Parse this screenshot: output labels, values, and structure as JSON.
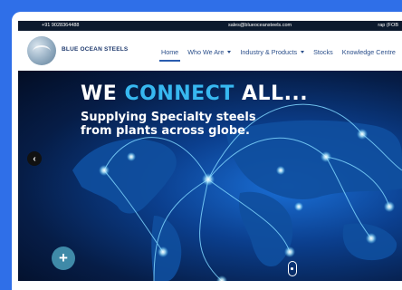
{
  "topbar": {
    "phone": "+91 9028364488",
    "email": "sales@blueoceansteels.com",
    "right_text": "rap (FOB"
  },
  "brand": {
    "logo_text": "BLUE OCEAN STEELS"
  },
  "nav": {
    "items": [
      {
        "label": "Home",
        "active": true,
        "dropdown": false
      },
      {
        "label": "Who We Are",
        "active": false,
        "dropdown": true
      },
      {
        "label": "Industry & Products",
        "active": false,
        "dropdown": true
      },
      {
        "label": "Stocks",
        "active": false,
        "dropdown": false
      },
      {
        "label": "Knowledge Centre",
        "active": false,
        "dropdown": false
      }
    ]
  },
  "hero": {
    "title_part1": "WE",
    "title_part2": "CONNECT",
    "title_part3": "ALL...",
    "subtitle": "Supplying Specialty steels from plants across globe."
  },
  "controls": {
    "prev_glyph": "‹",
    "plus_glyph": "+"
  },
  "colors": {
    "page_bg": "#2f6fe8",
    "topbar_bg": "#0c1a2e",
    "nav_text": "#2a4e8a",
    "accent_cyan": "#37b8f0",
    "plus_button": "#3f8aa8"
  },
  "icons": [
    "logo-mark-icon",
    "chevron-left-icon",
    "plus-icon",
    "scroll-indicator-icon",
    "caret-down-icon"
  ]
}
